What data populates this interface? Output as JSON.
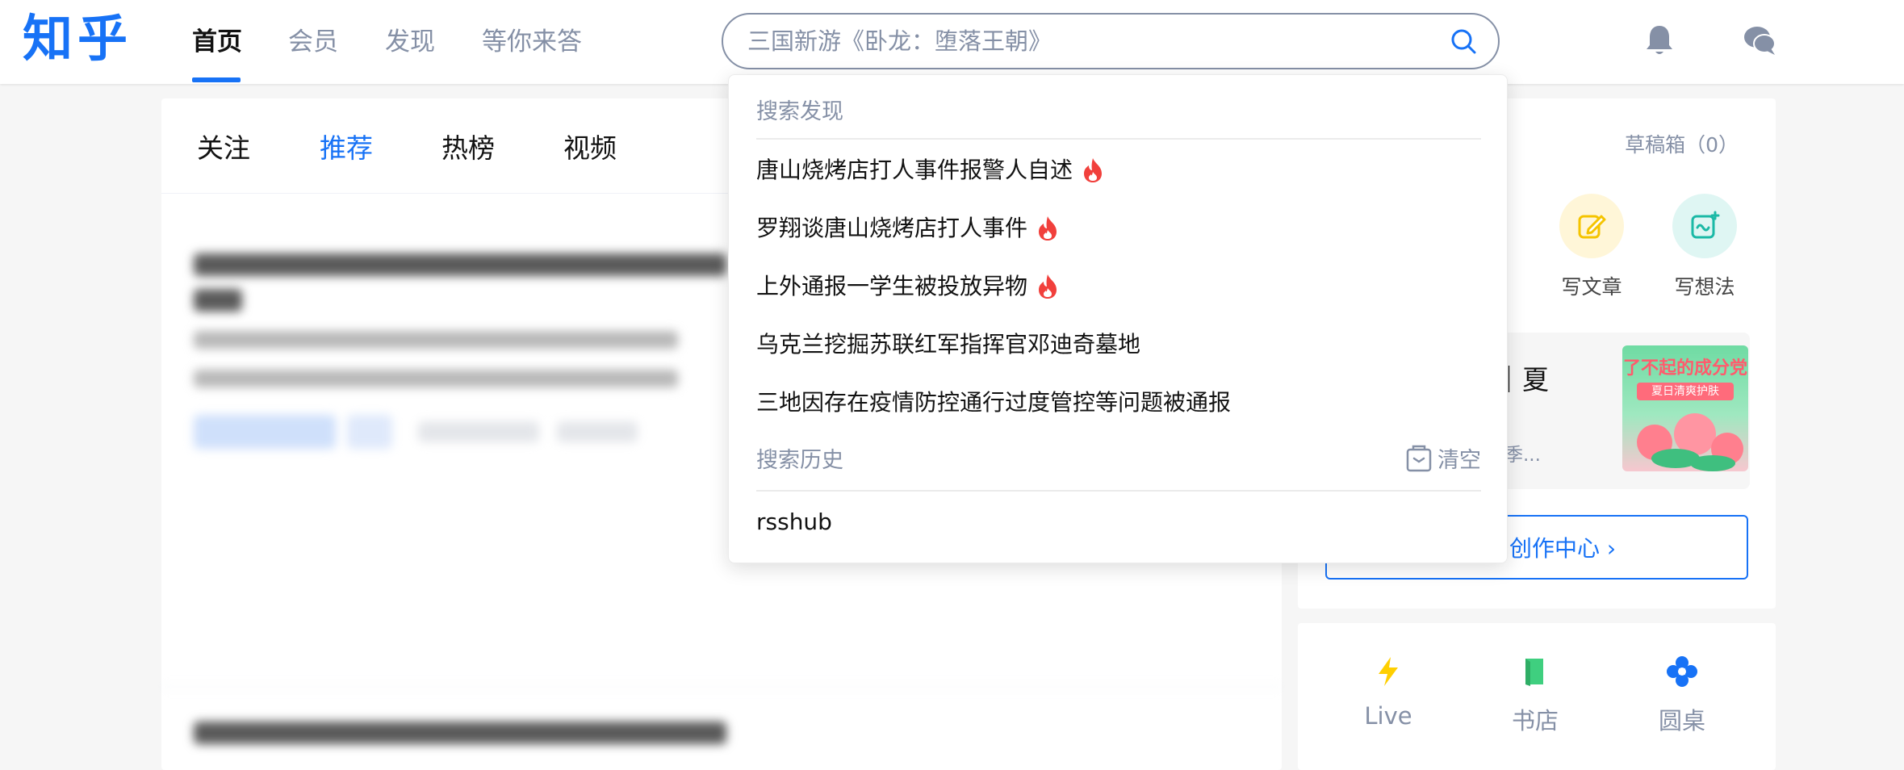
{
  "header": {
    "logo": "知乎",
    "nav": [
      "首页",
      "会员",
      "发现",
      "等你来答"
    ],
    "search_placeholder": "三国新游《卧龙：堕落王朝》"
  },
  "feed": {
    "tabs": [
      "关注",
      "推荐",
      "热榜",
      "视频"
    ]
  },
  "right": {
    "drafts": "草稿箱（0）",
    "write_article": "写文章",
    "write_idea": "写想法",
    "promo_title": "选｜夏",
    "promo_sub": "启夏季...",
    "promo_img_text": "了不起的成分党",
    "promo_img_sub": "夏日清爽护肤",
    "creator_center": "创作中心 ›",
    "tools": [
      "Live",
      "书店",
      "圆桌"
    ]
  },
  "dropdown": {
    "discover_title": "搜索发现",
    "discover_items": [
      {
        "text": "唐山烧烤店打人事件报警人自述",
        "hot": true
      },
      {
        "text": "罗翔谈唐山烧烤店打人事件",
        "hot": true
      },
      {
        "text": "上外通报一学生被投放异物",
        "hot": true
      },
      {
        "text": "乌克兰挖掘苏联红军指挥官邓迪奇墓地",
        "hot": false
      },
      {
        "text": "三地因存在疫情防控通行过度管控等问题被通报",
        "hot": false
      }
    ],
    "history_title": "搜索历史",
    "clear_label": "清空",
    "history_items": [
      "rsshub"
    ]
  },
  "colors": {
    "brand": "#1772f6",
    "muted": "#8590a6",
    "hot": "#f1403c"
  }
}
